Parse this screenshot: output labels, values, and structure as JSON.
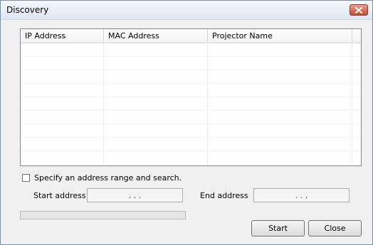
{
  "window": {
    "title": "Discovery",
    "close_icon": "close-icon"
  },
  "table": {
    "columns": [
      "IP Address",
      "MAC Address",
      "Projector Name"
    ],
    "rows": []
  },
  "range": {
    "checkbox_label": "Specify an address range and search.",
    "checked": false,
    "start_label": "Start address",
    "start_value": ".   .   .",
    "end_label": "End address",
    "end_value": ".   .   ."
  },
  "progress": {
    "value": 0
  },
  "buttons": {
    "start_label": "Start",
    "close_label": "Close"
  }
}
